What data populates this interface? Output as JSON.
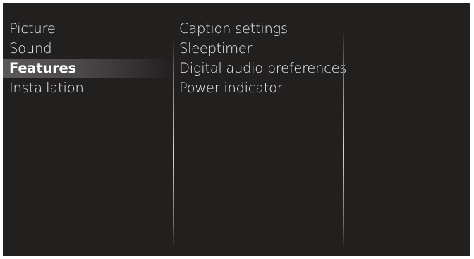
{
  "main_menu": {
    "items": [
      {
        "label": "Picture",
        "selected": false
      },
      {
        "label": "Sound",
        "selected": false
      },
      {
        "label": "Features",
        "selected": true
      },
      {
        "label": "Installation",
        "selected": false
      }
    ]
  },
  "submenu": {
    "items": [
      {
        "label": "Caption settings"
      },
      {
        "label": "Sleeptimer"
      },
      {
        "label": "Digital audio preferences"
      },
      {
        "label": "Power indicator"
      }
    ]
  },
  "colors": {
    "background": "#221f1f",
    "text": "#ececec",
    "highlight": "#5b5858"
  }
}
